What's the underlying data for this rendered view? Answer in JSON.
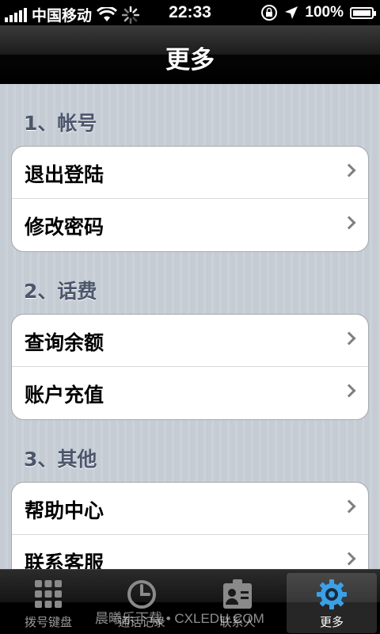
{
  "status_bar": {
    "carrier": "中国移动",
    "time": "22:33",
    "battery": "100%"
  },
  "nav": {
    "title": "更多"
  },
  "sections": [
    {
      "header": "1、帐号",
      "items": [
        "退出登陆",
        "修改密码"
      ]
    },
    {
      "header": "2、话费",
      "items": [
        "查询余额",
        "账户充值"
      ]
    },
    {
      "header": "3、其他",
      "items": [
        "帮助中心",
        "联系客服"
      ]
    }
  ],
  "tabs": [
    {
      "label": "拨号键盘",
      "icon": "keypad-icon"
    },
    {
      "label": "通话记录",
      "icon": "clock-icon"
    },
    {
      "label": "联系人",
      "icon": "contacts-icon"
    },
    {
      "label": "更多",
      "icon": "gear-icon",
      "selected": true
    }
  ],
  "watermark": "晨曦乐下载 • CXLEDU.COM",
  "colors": {
    "accent": "#3aa0e8",
    "section_text": "#4c566c",
    "background": "#c5ccd4"
  }
}
